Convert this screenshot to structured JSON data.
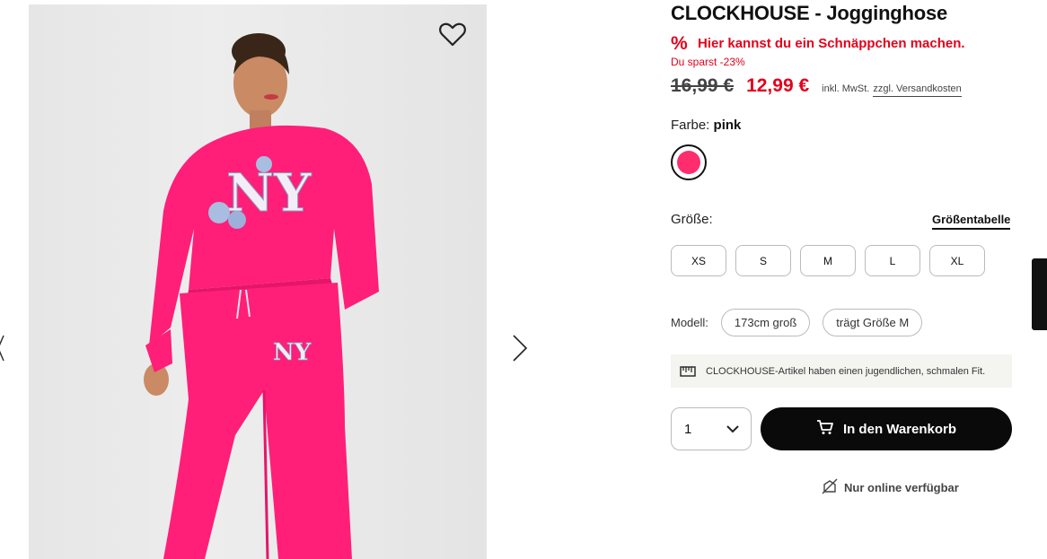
{
  "product": {
    "title": "CLOCKHOUSE - Jogginghose",
    "deal_text": "Hier kannst du ein Schnäppchen machen.",
    "deal_icon": "%",
    "savings": "Du sparst -23%",
    "old_price": "16,99 €",
    "new_price": "12,99 €",
    "vat_text": "inkl. MwSt.",
    "shipping_link": "zzgl. Versandkosten"
  },
  "color": {
    "label": "Farbe:",
    "value": "pink",
    "swatch_hex": "#ff2d6e"
  },
  "size": {
    "label": "Größe:",
    "chart_link": "Größentabelle",
    "options": [
      "XS",
      "S",
      "M",
      "L",
      "XL"
    ]
  },
  "model": {
    "label": "Modell:",
    "height": "173cm groß",
    "wears": "trägt Größe M"
  },
  "fit_note": "CLOCKHOUSE-Artikel haben einen jugendlichen, schmalen Fit.",
  "quantity": {
    "value": "1"
  },
  "cart_button": "In den Warenkorb",
  "availability": "Nur online verfügbar",
  "colors": {
    "accent_red": "#e3001b",
    "product_pink": "#ff2d6e",
    "button_black": "#0a0a0a"
  },
  "icons": {
    "favorite": "heart-icon",
    "next": "chevron-right-icon",
    "cart": "cart-icon",
    "fit": "ruler-icon",
    "online": "no-store-icon",
    "dropdown": "chevron-down-icon"
  }
}
